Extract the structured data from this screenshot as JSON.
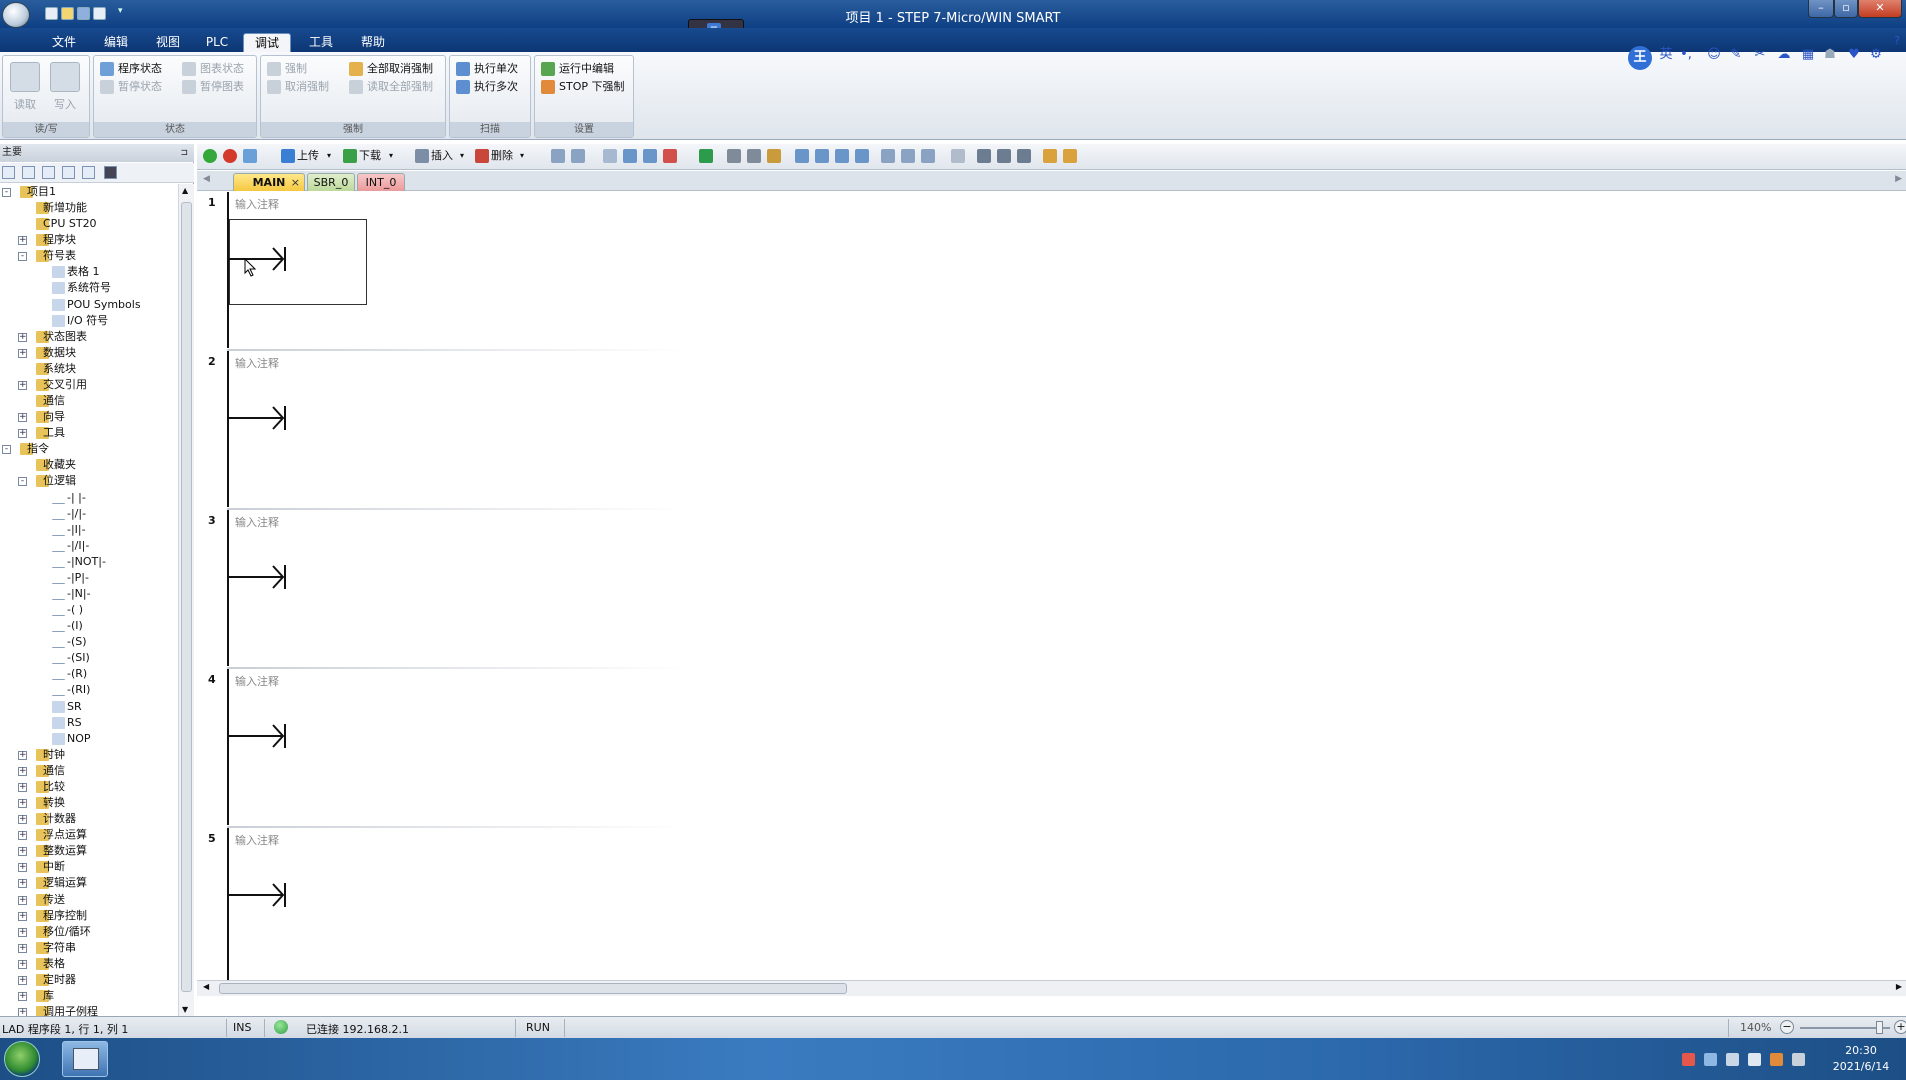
{
  "window": {
    "title": "项目 1 - STEP 7-Micro/WIN SMART"
  },
  "menu_tabs": [
    "文件",
    "编辑",
    "视图",
    "PLC",
    "调试",
    "工具",
    "帮助"
  ],
  "active_menu_tab": "调试",
  "ribbon": {
    "read_write": {
      "read": "读取",
      "write": "写入",
      "label": "读/写"
    },
    "status": {
      "program_status": "程序状态",
      "pause_status": "暂停状态",
      "chart_status": "图表状态",
      "pause_chart": "暂停图表",
      "label": "状态"
    },
    "force": {
      "force": "强制",
      "cancel_force": "取消强制",
      "cancel_all_force": "全部取消强制",
      "read_all_force": "读取全部强制",
      "label": "强制"
    },
    "scan": {
      "single_scan": "执行单次",
      "multi_scan": "执行多次",
      "label": "扫描"
    },
    "settings": {
      "run_edit": "运行中编辑",
      "stop_force": "STOP 下强制",
      "label": "设置"
    }
  },
  "ime_toolbar": {
    "logo": "王",
    "lang": "英",
    "punct": "•,"
  },
  "left_panel": {
    "title": "主要",
    "tree": [
      {
        "label": "项目1",
        "level": 0,
        "exp": "-"
      },
      {
        "label": "新增功能",
        "level": 1,
        "exp": ""
      },
      {
        "label": "CPU ST20",
        "level": 1,
        "exp": ""
      },
      {
        "label": "程序块",
        "level": 1,
        "exp": "+"
      },
      {
        "label": "符号表",
        "level": 1,
        "exp": "-"
      },
      {
        "label": "表格 1",
        "level": 2,
        "exp": ""
      },
      {
        "label": "系统符号",
        "level": 2,
        "exp": ""
      },
      {
        "label": "POU Symbols",
        "level": 2,
        "exp": ""
      },
      {
        "label": "I/O 符号",
        "level": 2,
        "exp": ""
      },
      {
        "label": "状态图表",
        "level": 1,
        "exp": "+"
      },
      {
        "label": "数据块",
        "level": 1,
        "exp": "+"
      },
      {
        "label": "系统块",
        "level": 1,
        "exp": ""
      },
      {
        "label": "交叉引用",
        "level": 1,
        "exp": "+"
      },
      {
        "label": "通信",
        "level": 1,
        "exp": ""
      },
      {
        "label": "向导",
        "level": 1,
        "exp": "+"
      },
      {
        "label": "工具",
        "level": 1,
        "exp": "+"
      },
      {
        "label": "指令",
        "level": 0,
        "exp": "-"
      },
      {
        "label": "收藏夹",
        "level": 1,
        "exp": ""
      },
      {
        "label": "位逻辑",
        "level": 1,
        "exp": "-"
      },
      {
        "label": "-| |-",
        "level": 2,
        "exp": ""
      },
      {
        "label": "-|/|-",
        "level": 2,
        "exp": ""
      },
      {
        "label": "-|I|-",
        "level": 2,
        "exp": ""
      },
      {
        "label": "-|/I|-",
        "level": 2,
        "exp": ""
      },
      {
        "label": "-|NOT|-",
        "level": 2,
        "exp": ""
      },
      {
        "label": "-|P|-",
        "level": 2,
        "exp": ""
      },
      {
        "label": "-|N|-",
        "level": 2,
        "exp": ""
      },
      {
        "label": "-( )",
        "level": 2,
        "exp": ""
      },
      {
        "label": "-(I)",
        "level": 2,
        "exp": ""
      },
      {
        "label": "-(S)",
        "level": 2,
        "exp": ""
      },
      {
        "label": "-(SI)",
        "level": 2,
        "exp": ""
      },
      {
        "label": "-(R)",
        "level": 2,
        "exp": ""
      },
      {
        "label": "-(RI)",
        "level": 2,
        "exp": ""
      },
      {
        "label": "SR",
        "level": 2,
        "exp": ""
      },
      {
        "label": "RS",
        "level": 2,
        "exp": ""
      },
      {
        "label": "NOP",
        "level": 2,
        "exp": ""
      },
      {
        "label": "时钟",
        "level": 1,
        "exp": "+"
      },
      {
        "label": "通信",
        "level": 1,
        "exp": "+"
      },
      {
        "label": "比较",
        "level": 1,
        "exp": "+"
      },
      {
        "label": "转换",
        "level": 1,
        "exp": "+"
      },
      {
        "label": "计数器",
        "level": 1,
        "exp": "+"
      },
      {
        "label": "浮点运算",
        "level": 1,
        "exp": "+"
      },
      {
        "label": "整数运算",
        "level": 1,
        "exp": "+"
      },
      {
        "label": "中断",
        "level": 1,
        "exp": "+"
      },
      {
        "label": "逻辑运算",
        "level": 1,
        "exp": "+"
      },
      {
        "label": "传送",
        "level": 1,
        "exp": "+"
      },
      {
        "label": "程序控制",
        "level": 1,
        "exp": "+"
      },
      {
        "label": "移位/循环",
        "level": 1,
        "exp": "+"
      },
      {
        "label": "字符串",
        "level": 1,
        "exp": "+"
      },
      {
        "label": "表格",
        "level": 1,
        "exp": "+"
      },
      {
        "label": "定时器",
        "level": 1,
        "exp": "+"
      },
      {
        "label": "库",
        "level": 1,
        "exp": "+"
      },
      {
        "label": "调用子例程",
        "level": 1,
        "exp": "+"
      }
    ]
  },
  "editor_toolbar": {
    "upload": "上传",
    "download": "下载",
    "insert": "插入",
    "delete": "删除"
  },
  "editor_tabs": [
    {
      "label": "MAIN",
      "close": "×"
    },
    {
      "label": "SBR_0",
      "close": ""
    },
    {
      "label": "INT_0",
      "close": ""
    }
  ],
  "networks": [
    {
      "number": "1",
      "comment": "输入注释"
    },
    {
      "number": "2",
      "comment": "输入注释"
    },
    {
      "number": "3",
      "comment": "输入注释"
    },
    {
      "number": "4",
      "comment": "输入注释"
    },
    {
      "number": "5",
      "comment": "输入注释"
    }
  ],
  "status_bar": {
    "position": "LAD 程序段 1, 行 1, 列 1",
    "mode": "INS",
    "connection": "已连接 192.168.2.1",
    "plc_state": "RUN",
    "zoom": "140%"
  },
  "taskbar": {
    "time": "20:30",
    "date": "2021/6/14"
  }
}
